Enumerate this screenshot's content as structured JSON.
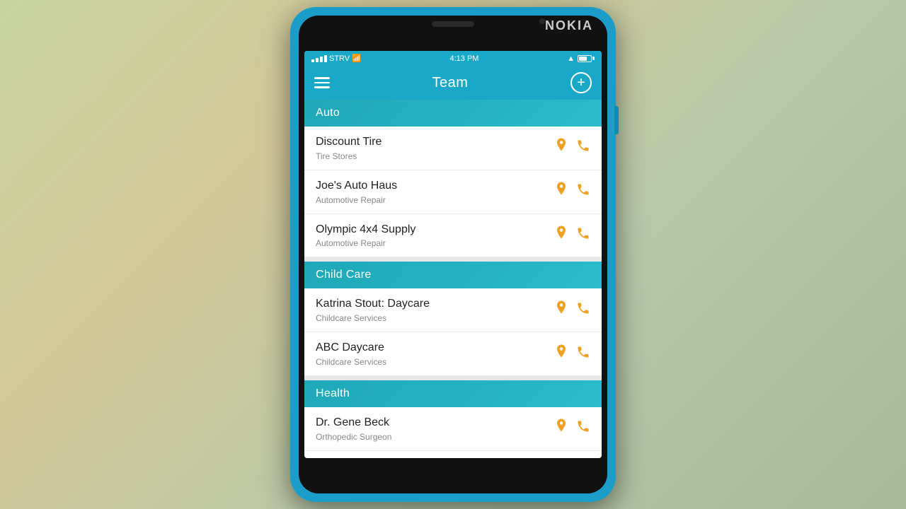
{
  "background": "#b8c8a0",
  "phone": {
    "brand": "NOKIA",
    "status_bar": {
      "carrier": "STRV",
      "time": "4:13 PM",
      "signal": "▲",
      "wifi": "wifi",
      "battery_level": 70
    },
    "app_bar": {
      "title": "Team",
      "add_button_label": "+"
    },
    "sections": [
      {
        "id": "auto",
        "label": "Auto",
        "items": [
          {
            "id": "discount-tire",
            "name": "Discount Tire",
            "subtitle": "Tire Stores",
            "has_location": true,
            "has_phone": true
          },
          {
            "id": "joes-auto",
            "name": "Joe's Auto Haus",
            "subtitle": "Automotive Repair",
            "has_location": true,
            "has_phone": true
          },
          {
            "id": "olympic-4x4",
            "name": "Olympic 4x4 Supply",
            "subtitle": "Automotive Repair",
            "has_location": true,
            "has_phone": true
          }
        ]
      },
      {
        "id": "child-care",
        "label": "Child Care",
        "items": [
          {
            "id": "katrina-stout",
            "name": "Katrina Stout: Daycare",
            "subtitle": "Childcare Services",
            "has_location": true,
            "has_phone": true
          },
          {
            "id": "abc-daycare",
            "name": "ABC Daycare",
            "subtitle": "Childcare Services",
            "has_location": true,
            "has_phone": true
          }
        ]
      },
      {
        "id": "health",
        "label": "Health",
        "items": [
          {
            "id": "dr-gene-beck",
            "name": "Dr. Gene Beck",
            "subtitle": "Orthopedic Surgeon",
            "has_location": true,
            "has_phone": true
          }
        ]
      }
    ]
  }
}
